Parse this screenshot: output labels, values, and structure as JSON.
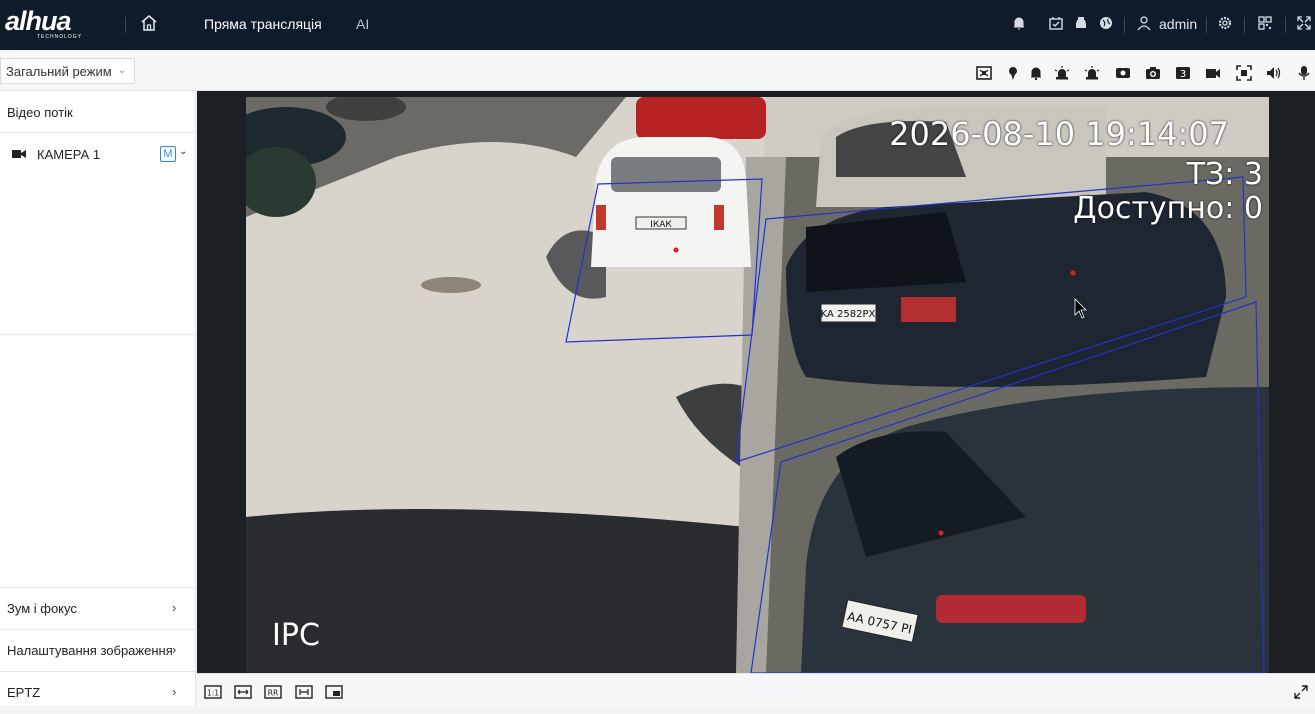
{
  "brand": {
    "name": "alhua",
    "sub": "TECHNOLOGY"
  },
  "nav": {
    "live": "Пряма трансляція",
    "ai": "AI"
  },
  "user": {
    "name": "admin"
  },
  "toolbar": {
    "mode": "Загальний режим"
  },
  "sidebar": {
    "stream_title": "Відео потік",
    "camera": {
      "label": "КАМЕРА 1",
      "badge": "M"
    },
    "sections": [
      {
        "label": "Зум і фокус"
      },
      {
        "label": "Налаштування зображення"
      },
      {
        "label": "EPTZ"
      }
    ]
  },
  "video": {
    "timestamp": "2026-08-10 19:14:07",
    "line1": "ТЗ: 3",
    "line2": "Доступно: 0",
    "channel_label": "IPC",
    "plate1": "ІКАК",
    "plate2": "KA 2582PX",
    "plate3": "AA 0757 PI"
  },
  "colors": {
    "topbar": "#0d1b2a",
    "accent": "#2a8cd8",
    "zone": "#2233cc"
  },
  "icons": {
    "top": [
      "home-icon",
      "bell-icon",
      "event-icon",
      "car-icon",
      "globe-icon",
      "user-icon",
      "settings-icon",
      "grid-icon",
      "fullscreen-icon"
    ],
    "toolbar": [
      "ai-detect-icon",
      "pin-icon",
      "alarm-icon",
      "alarm-light-icon",
      "siren-icon",
      "record-icon",
      "snapshot-icon",
      "triple-snapshot-icon",
      "video-record-icon",
      "focus-icon",
      "audio-icon",
      "microphone-icon"
    ],
    "bottom": [
      "original-size-icon",
      "fit-width-icon",
      "ratio-icon",
      "stretch-icon",
      "pip-icon",
      "exit-fullscreen-icon"
    ]
  }
}
